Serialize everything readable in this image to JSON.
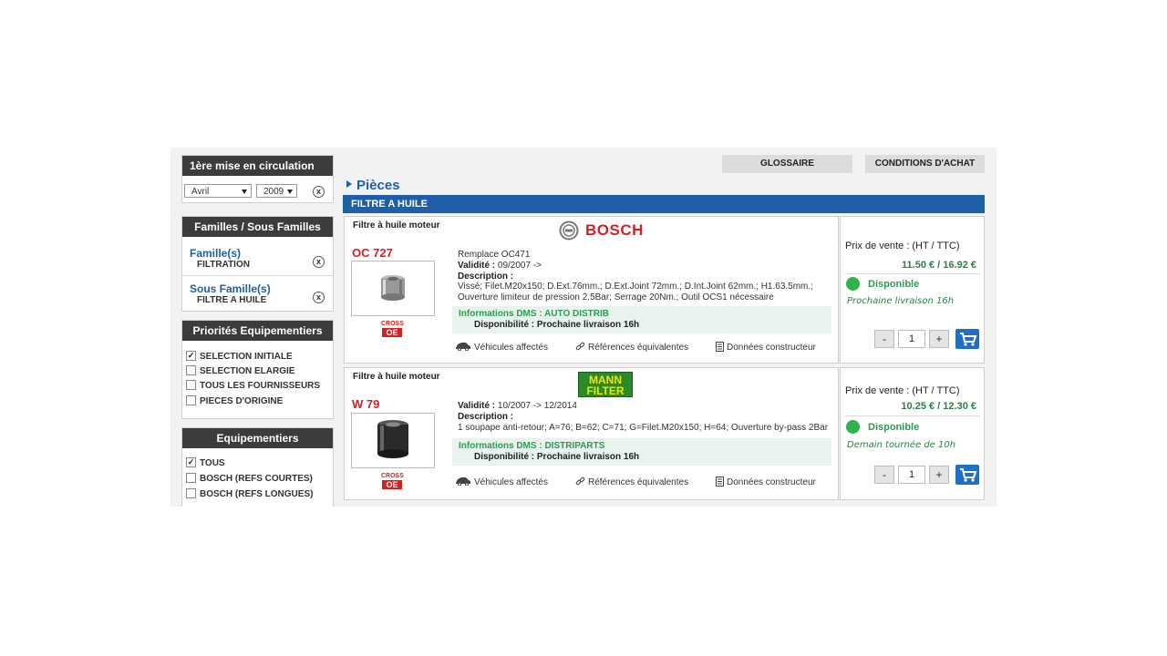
{
  "sidebar": {
    "circulation": {
      "title": "1ère mise en circulation",
      "month": "Avril",
      "year": "2009",
      "clear": "x"
    },
    "familles": {
      "title": "Familles / Sous Familles",
      "famille_label": "Famille(s)",
      "famille_value": "FILTRATION",
      "sous_famille_label": "Sous Famille(s)",
      "sous_famille_value": "FILTRE A HUILE",
      "clear": "x"
    },
    "priorites": {
      "title": "Priorités Equipementiers",
      "items": [
        {
          "label": "SELECTION INITIALE",
          "checked": true
        },
        {
          "label": "SELECTION ELARGIE",
          "checked": false
        },
        {
          "label": "TOUS LES FOURNISSEURS",
          "checked": false
        },
        {
          "label": "PIECES D'ORIGINE",
          "checked": false
        }
      ]
    },
    "equipementiers": {
      "title": "Equipementiers",
      "items": [
        {
          "label": "TOUS",
          "checked": true
        },
        {
          "label": "BOSCH (REFS COURTES)",
          "checked": false
        },
        {
          "label": "BOSCH (REFS LONGUES)",
          "checked": false
        }
      ]
    }
  },
  "toolbar": {
    "glossaire": "GLOSSAIRE",
    "conditions": "CONDITIONS D'ACHAT"
  },
  "main": {
    "title": "Pièces",
    "section": "FILTRE A HUILE",
    "products": [
      {
        "type": "Filtre à huile moteur",
        "brand": "BOSCH",
        "ref": "OC 727",
        "replace": "Remplace OC471",
        "validite_label": "Validité :",
        "validite": "09/2007 ->",
        "description_label": "Description :",
        "description": "Vissé; Filet.M20x150; D.Ext.76mm.; D.Ext.Joint 72mm.; D.Int.Joint 62mm.; H1.63.5mm.; Ouverture limiteur de pression 2.5Bar; Serrage 20Nm.; Outil OCS1 nécessaire",
        "dms_title": "Informations DMS : AUTO DISTRIB",
        "dms_dispo": "Disponibilité : Prochaine livraison 16h",
        "cross_top": "CROSS",
        "cross_bottom": "OE",
        "link_vehicules": "Véhicules affectés",
        "link_refs": "Références équivalentes",
        "link_donnees": "Données constructeur",
        "price_label": "Prix de vente : (HT / TTC)",
        "price": "11.50 €  / 16.92 €",
        "dispo": "Disponible",
        "livraison": "Prochaine livraison 16h",
        "qty": "1",
        "minus": "-",
        "plus": "+"
      },
      {
        "type": "Filtre à huile moteur",
        "brand_line1": "MANN",
        "brand_line2": "FILTER",
        "ref": "W 79",
        "validite_label": "Validité :",
        "validite": "10/2007 -> 12/2014",
        "description_label": "Description :",
        "description": "1 soupape anti-retour; A=76; B=62; C=71; G=Filet.M20x150; H=64; Ouverture by-pass 2Bar",
        "dms_title": "Informations DMS : DISTRIPARTS",
        "dms_dispo": "Disponibilité : Prochaine livraison 16h",
        "cross_top": "CROSS",
        "cross_bottom": "OE",
        "link_vehicules": "Véhicules affectés",
        "link_refs": "Références équivalentes",
        "link_donnees": "Données constructeur",
        "price_label": "Prix de vente : (HT / TTC)",
        "price": "10.25 €  / 12.30 €",
        "dispo": "Disponible",
        "livraison": "Demain tournée de 10h",
        "qty": "1",
        "minus": "-",
        "plus": "+"
      }
    ]
  },
  "colors": {
    "accent": "#1f5fa8",
    "header_dark": "#3c3c3c",
    "price_green": "#2e7d4a",
    "available_dot": "#2fb34c",
    "ref_red": "#d62020",
    "mann_yellow": "#2a8a2a"
  }
}
